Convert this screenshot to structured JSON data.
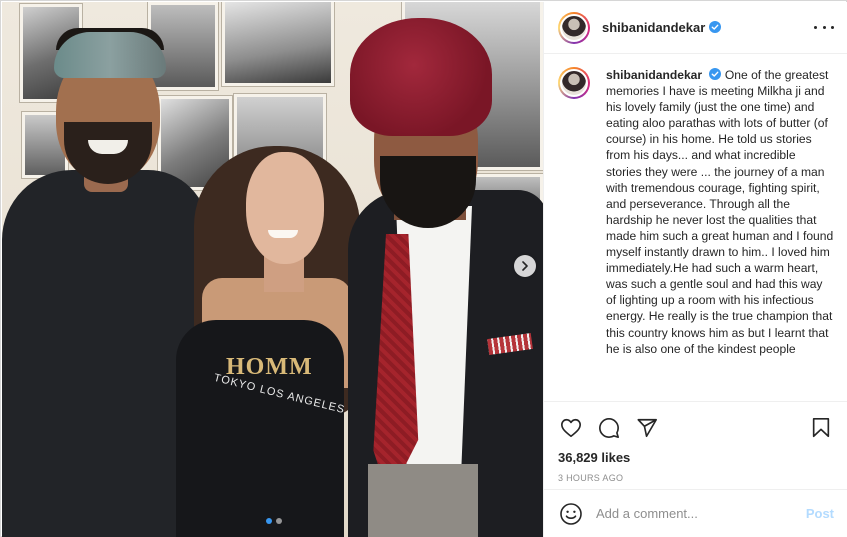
{
  "post": {
    "username": "shibanidandekar",
    "verified": true,
    "caption": "One of the greatest memories I have is meeting Milkha ji and his lovely family (just the one time) and eating aloo parathas with lots of butter (of course) in his home. He told us stories from his days... and what incredible stories they were ... the journey of a man with tremendous courage, fighting spirit, and perseverance. Through all the hardship he never lost the qualities that made him such a great human and I found myself instantly drawn to him.. I loved him immediately.He had such a warm heart, was such a gentle soul and had this way of lighting up a room with his infectious energy. He really is the true champion that this country knows him as but I learnt that he is also one of the kindest people",
    "likes": "36,829 likes",
    "timestamp": "3 HOURS AGO"
  },
  "photo": {
    "shirt_print_main": "HOMM",
    "shirt_print_sub": "TOKYO LOS ANGELES",
    "carousel": {
      "count": 2,
      "active_index": 0
    }
  },
  "comment": {
    "placeholder": "Add a comment...",
    "post_label": "Post"
  },
  "icons": {
    "more": "more-options-icon",
    "like": "heart-icon",
    "comment": "comment-icon",
    "share": "paper-plane-icon",
    "save": "bookmark-icon",
    "emoji": "emoji-icon",
    "next": "chevron-right-icon",
    "verified": "verified-badge-icon"
  },
  "colors": {
    "verified": "#3897f0",
    "post_button_disabled": "#b3dbff",
    "muted_text": "#8e8e8e",
    "turban": "#8e1c2c",
    "tie": "#a5242c"
  }
}
